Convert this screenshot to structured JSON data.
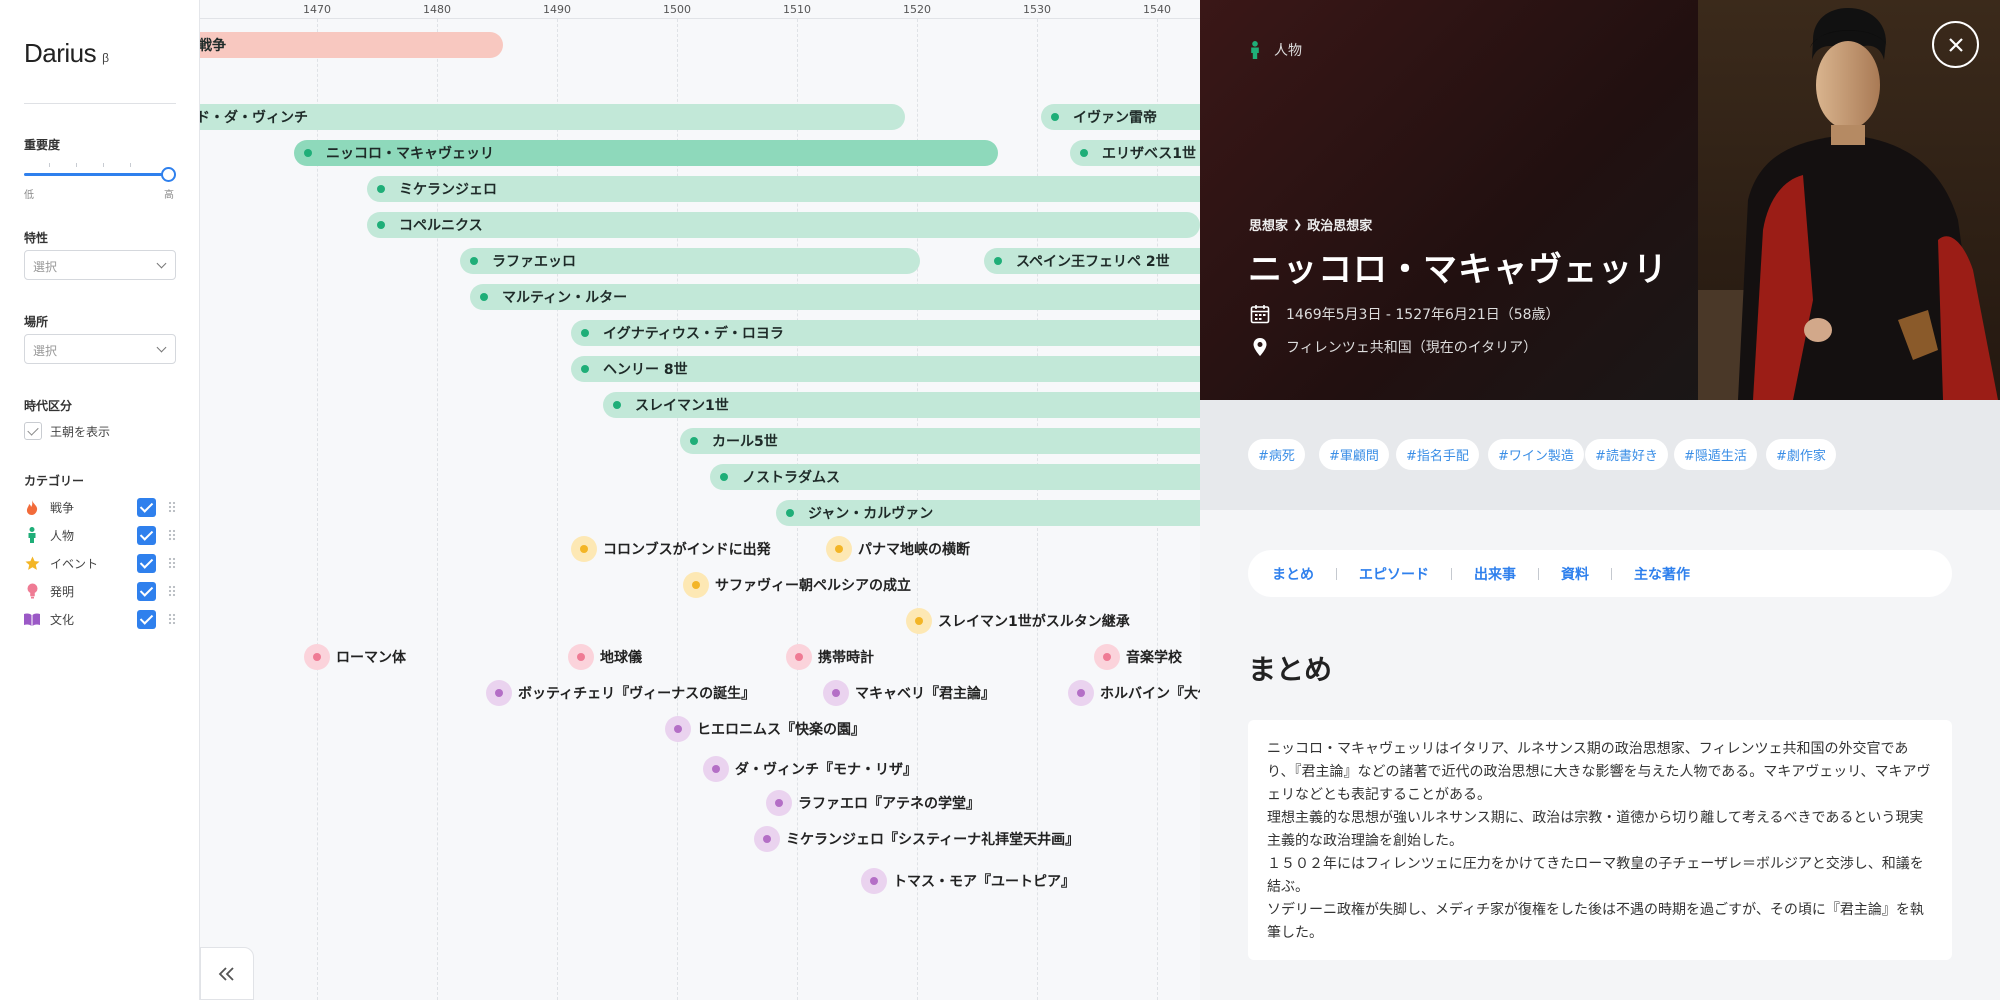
{
  "app": {
    "name": "Darius",
    "beta": "β"
  },
  "filters": {
    "importance": {
      "label": "重要度",
      "min_label": "低",
      "max_label": "高",
      "level": 1.0
    },
    "trait": {
      "label": "特性",
      "placeholder": "選択"
    },
    "place": {
      "label": "場所",
      "placeholder": "選択"
    },
    "era": {
      "label": "時代区分",
      "dynasty_label": "王朝を表示"
    },
    "categories": {
      "label": "カテゴリー",
      "items": [
        {
          "label": "戦争",
          "icon": "fire-icon",
          "color": "#f26b3a",
          "checked": true
        },
        {
          "label": "人物",
          "icon": "person-icon",
          "color": "#1fae78",
          "checked": true
        },
        {
          "label": "イベント",
          "icon": "star-icon",
          "color": "#f3b526",
          "checked": true
        },
        {
          "label": "発明",
          "icon": "lightbulb-icon",
          "color": "#ef7b94",
          "checked": true
        },
        {
          "label": "文化",
          "icon": "book-icon",
          "color": "#9b59c6",
          "checked": true
        }
      ]
    }
  },
  "timeline": {
    "ticks": [
      "1470",
      "1480",
      "1490",
      "1500",
      "1510",
      "1520",
      "1530",
      "1540"
    ],
    "wars": [
      {
        "label": "戦争"
      }
    ],
    "persons": [
      {
        "label": "ド・ダ・ヴィンチ"
      },
      {
        "label": "イヴァン雷帝"
      },
      {
        "label": "ニッコロ・マキャヴェッリ",
        "active": true
      },
      {
        "label": "エリザベス1世"
      },
      {
        "label": "ミケランジェロ"
      },
      {
        "label": "コペルニクス"
      },
      {
        "label": "ラファエッロ"
      },
      {
        "label": "スペイン王フェリペ 2世"
      },
      {
        "label": "マルティン・ルター"
      },
      {
        "label": "イグナティウス・デ・ロヨラ"
      },
      {
        "label": "ヘンリー 8世"
      },
      {
        "label": "スレイマン1世"
      },
      {
        "label": "カール5世"
      },
      {
        "label": "ノストラダムス"
      },
      {
        "label": "ジャン・カルヴァン"
      }
    ],
    "events": [
      {
        "label": "コロンブスがインドに出発",
        "kind": "event"
      },
      {
        "label": "パナマ地峡の横断",
        "kind": "event"
      },
      {
        "label": "サファヴィー朝ペルシアの成立",
        "kind": "event"
      },
      {
        "label": "スレイマン1世がスルタン継承",
        "kind": "event"
      },
      {
        "label": "ローマン体",
        "kind": "invention"
      },
      {
        "label": "地球儀",
        "kind": "invention"
      },
      {
        "label": "携帯時計",
        "kind": "invention"
      },
      {
        "label": "音楽学校",
        "kind": "invention"
      },
      {
        "label": "ボッティチェリ『ヴィーナスの誕生』",
        "kind": "culture"
      },
      {
        "label": "マキャベリ『君主論』",
        "kind": "culture"
      },
      {
        "label": "ホルバイン『大使たち』",
        "kind": "culture"
      },
      {
        "label": "ヒエロニムス『快楽の園』",
        "kind": "culture"
      },
      {
        "label": "ダ・ヴィンチ『モナ・リザ』",
        "kind": "culture"
      },
      {
        "label": "ラファエロ『アテネの学堂』",
        "kind": "culture"
      },
      {
        "label": "ミケランジェロ『システィーナ礼拝堂天井画』",
        "kind": "culture"
      },
      {
        "label": "トマス・モア『ユートピア』",
        "kind": "culture"
      }
    ]
  },
  "detail": {
    "category": "人物",
    "breadcrumb": [
      "思想家",
      "政治思想家"
    ],
    "title": "ニッコロ・マキャヴェッリ",
    "dates": "1469年5月3日 - 1527年6月21日（58歳）",
    "place": "フィレンツェ共和国（現在のイタリア）",
    "tags": [
      "#病死",
      "#軍顧問",
      "#指名手配",
      "#ワイン製造",
      "#読書好き",
      "#隠遁生活",
      "#劇作家"
    ],
    "tabs": [
      "まとめ",
      "エピソード",
      "出来事",
      "資料",
      "主な著作"
    ],
    "section_title": "まとめ",
    "summary": [
      "ニッコロ・マキャヴェッリはイタリア、ルネサンス期の政治思想家、フィレンツェ共和国の外交官であり、『君主論』などの諸著で近代の政治思想に大きな影響を与えた人物である。マキアヴェッリ、マキアヴェリなどとも表記することがある。",
      "理想主義的な思想が強いルネサンス期に、政治は宗教・道徳から切り離して考えるべきであるという現実主義的な政治理論を創始した。",
      "１５０２年にはフィレンツェに圧力をかけてきたローマ教皇の子チェーザレ＝ボルジアと交渉し、和議を結ぶ。",
      "ソデリーニ政権が失脚し、メディチ家が復権をした後は不遇の時期を過ごすが、その頃に『君主論』を執筆した。"
    ]
  }
}
